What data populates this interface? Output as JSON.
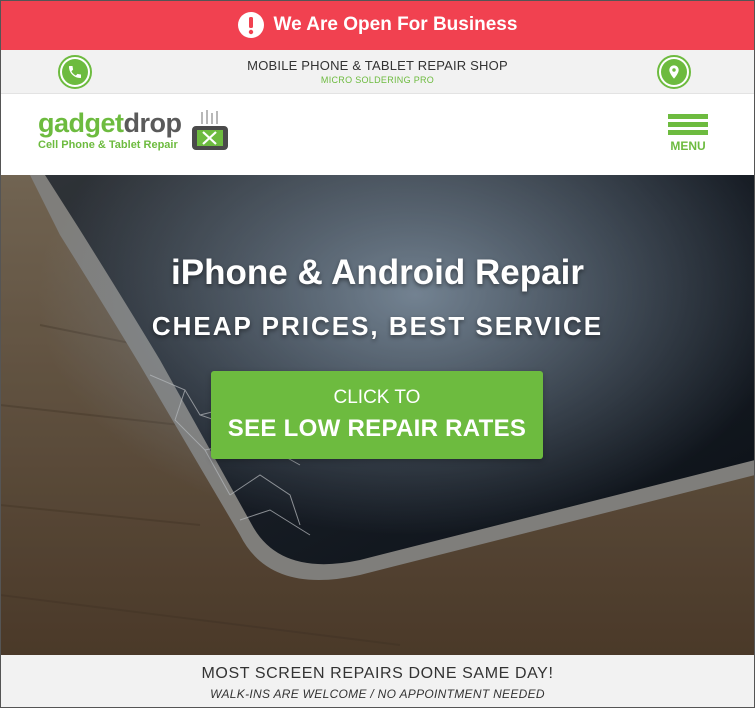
{
  "alert": {
    "text": "We Are Open For Business",
    "icon": "exclamation-icon",
    "background": "#f14150"
  },
  "info_bar": {
    "title": "MOBILE PHONE & TABLET REPAIR SHOP",
    "subtitle": "MICRO SOLDERING PRO",
    "left_icon": "phone-icon",
    "right_icon": "map-pin-icon"
  },
  "header": {
    "logo_part1": "gadget",
    "logo_part2": "drop",
    "logo_tagline": "Cell Phone & Tablet Repair",
    "menu_label": "MENU"
  },
  "hero": {
    "title": "iPhone & Android Repair",
    "subtitle": "CHEAP PRICES, BEST SERVICE",
    "cta_line1": "CLICK TO",
    "cta_line2": "SEE LOW REPAIR RATES"
  },
  "strip": {
    "title": "MOST SCREEN REPAIRS DONE SAME DAY!",
    "subtitle": "WALK-INS ARE WELCOME / NO APPOINTMENT NEEDED"
  },
  "colors": {
    "accent_green": "#6dbb3f",
    "alert_red": "#f14150",
    "strip_gray": "#f2f2f2"
  }
}
